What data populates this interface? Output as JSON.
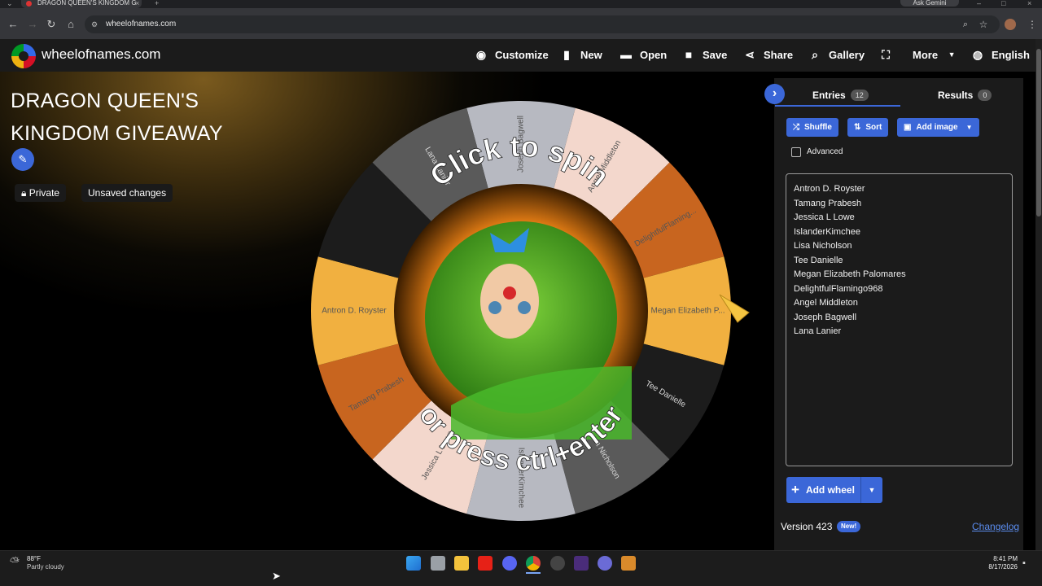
{
  "browser": {
    "tab_title": "DRAGON QUEEN'S KINGDOM G",
    "url": "wheelofnames.com",
    "gemini_label": "Ask Gemini"
  },
  "site": {
    "name": "wheelofnames.com",
    "menu": [
      {
        "label": "Customize",
        "icon": "palette-icon"
      },
      {
        "label": "New",
        "icon": "new-file-icon"
      },
      {
        "label": "Open",
        "icon": "folder-icon"
      },
      {
        "label": "Save",
        "icon": "save-icon"
      },
      {
        "label": "Share",
        "icon": "share-icon"
      },
      {
        "label": "Gallery",
        "icon": "search-icon"
      },
      {
        "label": "",
        "icon": "fullscreen-icon"
      },
      {
        "label": "More",
        "icon": "chevron-down-icon"
      },
      {
        "label": "English",
        "icon": "globe-icon"
      }
    ]
  },
  "main": {
    "title": "DRAGON QUEEN'S KINGDOM GIVEAWAY",
    "private_label": "Private",
    "unsaved_label": "Unsaved changes"
  },
  "wheel": {
    "center_text_top": "Click to spin",
    "center_text_bottom": "or press ctrl+enter",
    "pointer_color": "#f5c542",
    "segments": [
      {
        "label": "Joseph Bagwell",
        "color": "#b7b9c1"
      },
      {
        "label": "Angel Middleton",
        "color": "#f3d7cc"
      },
      {
        "label": "DelightfulFlaming...",
        "color": "#c8651f"
      },
      {
        "label": "Megan Elizabeth P...",
        "color": "#f1b040"
      },
      {
        "label": "Tee Danielle",
        "color": "#1c1c1c"
      },
      {
        "label": "Lisa Nicholson",
        "color": "#5a5a5a"
      },
      {
        "label": "IslanderKimchee",
        "color": "#b7b9c1"
      },
      {
        "label": "Jessica L Lowe",
        "color": "#f3d7cc"
      },
      {
        "label": "Tamang Prabesh",
        "color": "#c8651f"
      },
      {
        "label": "Antron D. Royster",
        "color": "#f1b040"
      },
      {
        "label": "",
        "color": "#1c1c1c"
      },
      {
        "label": "Lana Lanier",
        "color": "#5a5a5a"
      }
    ]
  },
  "panel": {
    "tabs": [
      {
        "label": "Entries",
        "count": "12"
      },
      {
        "label": "Results",
        "count": "0"
      }
    ],
    "shuffle_label": "Shuffle",
    "sort_label": "Sort",
    "add_image_label": "Add image",
    "advanced_label": "Advanced",
    "entries": [
      "Antron D. Royster",
      "Tamang Prabesh",
      "Jessica L Lowe",
      "IslanderKimchee",
      "Lisa Nicholson",
      "Tee Danielle",
      "Megan Elizabeth Palomares",
      "DelightfulFlamingo968",
      "Angel Middleton",
      "Joseph Bagwell",
      "Lana Lanier"
    ],
    "add_wheel_label": "Add wheel",
    "version_label": "Version 423",
    "new_badge": "New!",
    "changelog_label": "Changelog",
    "accent_color": "#3b67d8"
  },
  "taskbar": {
    "weather_temp": "88°F",
    "weather_desc": "Partly cloudy",
    "time": "8:41 PM",
    "date": "8/17/2026"
  }
}
